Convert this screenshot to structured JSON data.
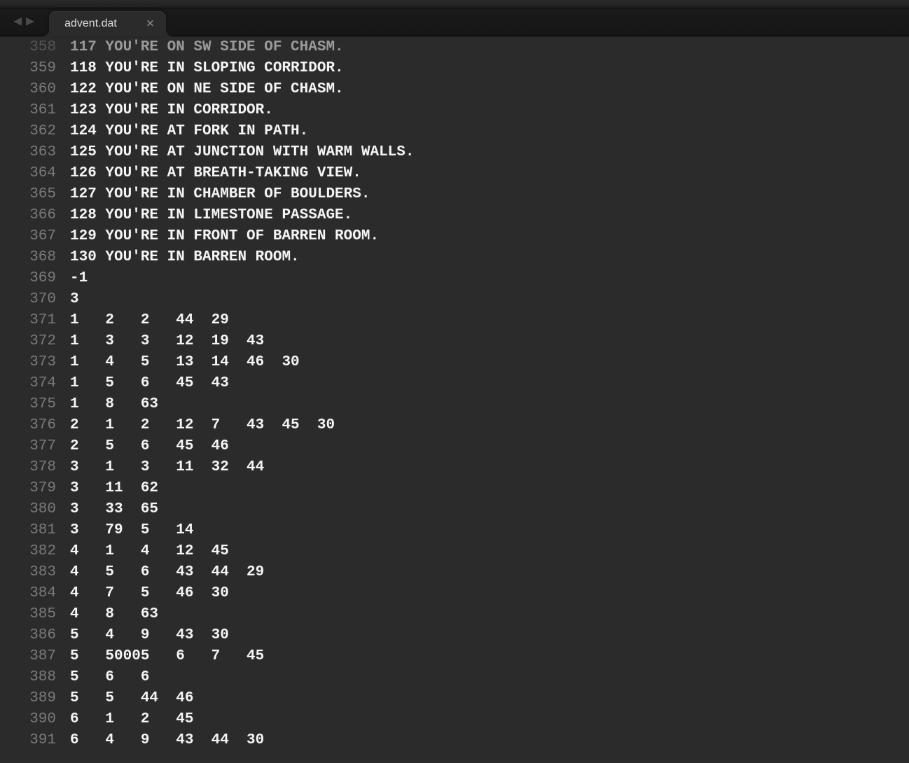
{
  "tab": {
    "title": "advent.dat"
  },
  "editor": {
    "lines": [
      {
        "n": 358,
        "text": "117 YOU'RE ON SW SIDE OF CHASM."
      },
      {
        "n": 359,
        "text": "118 YOU'RE IN SLOPING CORRIDOR."
      },
      {
        "n": 360,
        "text": "122 YOU'RE ON NE SIDE OF CHASM."
      },
      {
        "n": 361,
        "text": "123 YOU'RE IN CORRIDOR."
      },
      {
        "n": 362,
        "text": "124 YOU'RE AT FORK IN PATH."
      },
      {
        "n": 363,
        "text": "125 YOU'RE AT JUNCTION WITH WARM WALLS."
      },
      {
        "n": 364,
        "text": "126 YOU'RE AT BREATH-TAKING VIEW."
      },
      {
        "n": 365,
        "text": "127 YOU'RE IN CHAMBER OF BOULDERS."
      },
      {
        "n": 366,
        "text": "128 YOU'RE IN LIMESTONE PASSAGE."
      },
      {
        "n": 367,
        "text": "129 YOU'RE IN FRONT OF BARREN ROOM."
      },
      {
        "n": 368,
        "text": "130 YOU'RE IN BARREN ROOM."
      },
      {
        "n": 369,
        "text": "-1"
      },
      {
        "n": 370,
        "text": "3"
      },
      {
        "n": 371,
        "text": "1   2   2   44  29"
      },
      {
        "n": 372,
        "text": "1   3   3   12  19  43"
      },
      {
        "n": 373,
        "text": "1   4   5   13  14  46  30"
      },
      {
        "n": 374,
        "text": "1   5   6   45  43"
      },
      {
        "n": 375,
        "text": "1   8   63"
      },
      {
        "n": 376,
        "text": "2   1   2   12  7   43  45  30"
      },
      {
        "n": 377,
        "text": "2   5   6   45  46"
      },
      {
        "n": 378,
        "text": "3   1   3   11  32  44"
      },
      {
        "n": 379,
        "text": "3   11  62"
      },
      {
        "n": 380,
        "text": "3   33  65"
      },
      {
        "n": 381,
        "text": "3   79  5   14"
      },
      {
        "n": 382,
        "text": "4   1   4   12  45"
      },
      {
        "n": 383,
        "text": "4   5   6   43  44  29"
      },
      {
        "n": 384,
        "text": "4   7   5   46  30"
      },
      {
        "n": 385,
        "text": "4   8   63"
      },
      {
        "n": 386,
        "text": "5   4   9   43  30"
      },
      {
        "n": 387,
        "text": "5   50005   6   7   45"
      },
      {
        "n": 388,
        "text": "5   6   6"
      },
      {
        "n": 389,
        "text": "5   5   44  46"
      },
      {
        "n": 390,
        "text": "6   1   2   45"
      },
      {
        "n": 391,
        "text": "6   4   9   43  44  30"
      }
    ]
  }
}
